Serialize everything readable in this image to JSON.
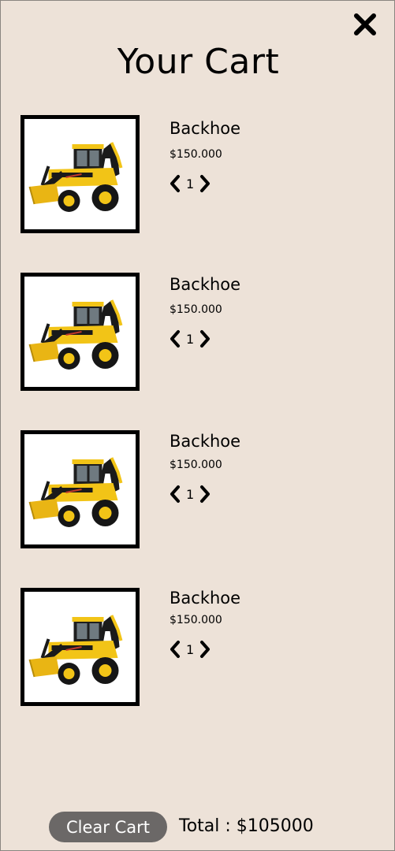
{
  "header": {
    "title": "Your Cart",
    "close_icon": "close-icon"
  },
  "cart": {
    "items": [
      {
        "name": "Backhoe",
        "price": "$150.000",
        "quantity": "1",
        "image": "backhoe-image"
      },
      {
        "name": "Backhoe",
        "price": "$150.000",
        "quantity": "1",
        "image": "backhoe-image"
      },
      {
        "name": "Backhoe",
        "price": "$150.000",
        "quantity": "1",
        "image": "backhoe-image"
      },
      {
        "name": "Backhoe",
        "price": "$150.000",
        "quantity": "1",
        "image": "backhoe-image"
      }
    ]
  },
  "footer": {
    "clear_label": "Clear Cart",
    "total_label": "Total : $105000"
  },
  "colors": {
    "background": "#ede2d8",
    "clear_button": "#6b6867",
    "machine_yellow": "#f2c417"
  }
}
